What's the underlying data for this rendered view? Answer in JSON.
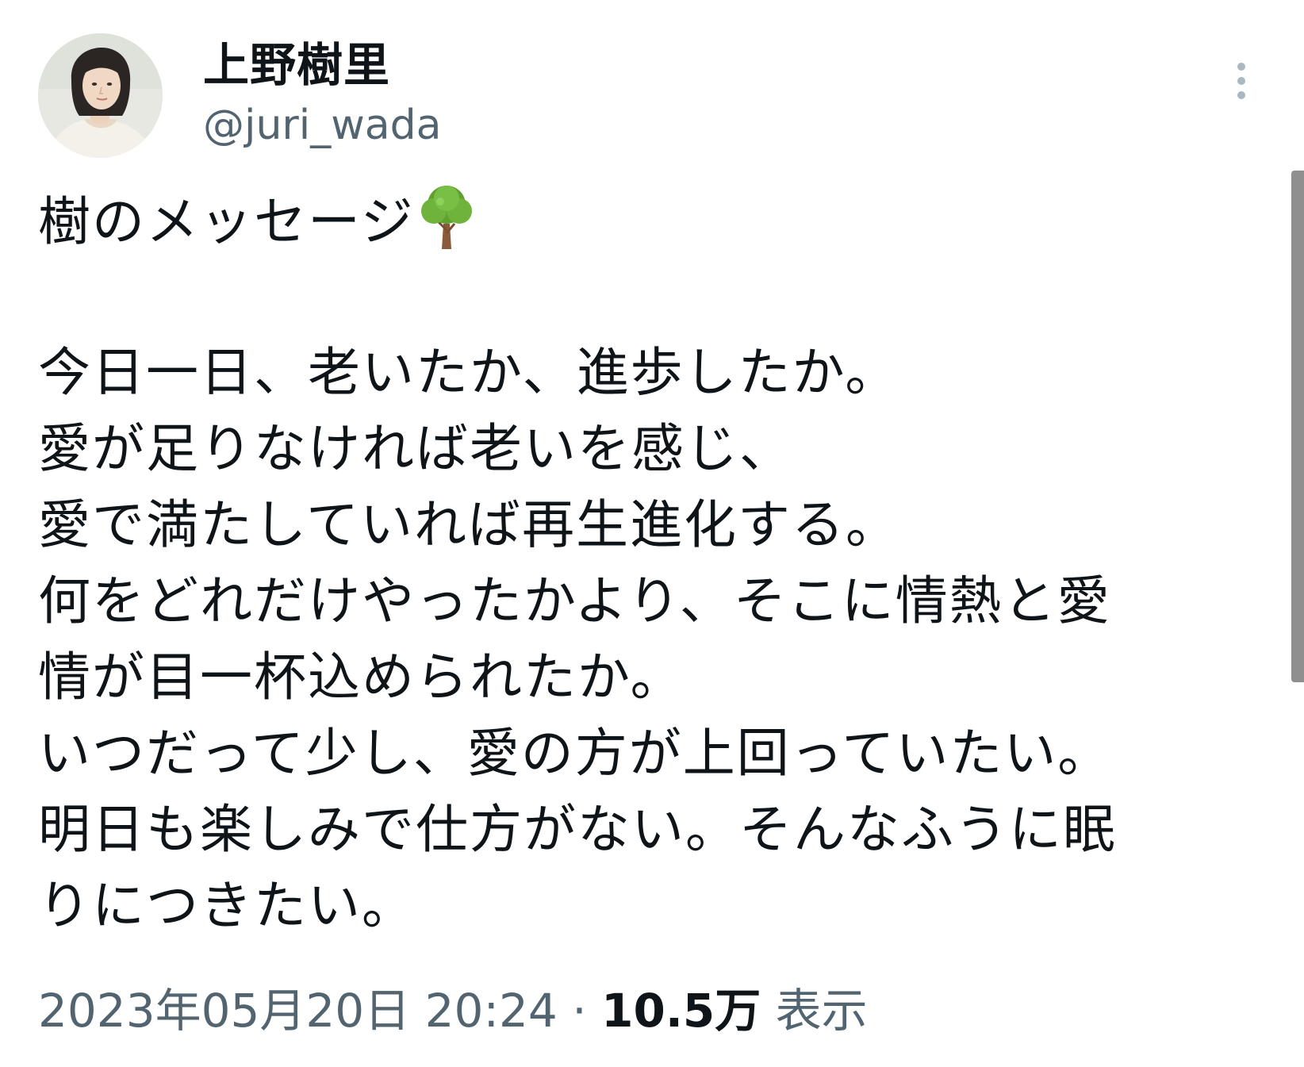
{
  "author": {
    "display_name": "上野樹里",
    "handle": "@juri_wada"
  },
  "tweet": {
    "title_text": "樹のメッセージ",
    "title_emoji": "tree-icon",
    "lines": [
      "今日一日、老いたか、進歩したか。",
      "愛が足りなければ老いを感じ、",
      "愛で満たしていれば再生進化する。",
      "何をどれだけやったかより、そこに情熱と愛",
      "情が目一杯込められたか。",
      "いつだって少し、愛の方が上回っていたい。",
      "明日も楽しみで仕方がない。そんなふうに眠",
      "りにつきたい。"
    ]
  },
  "meta": {
    "timestamp": "2023年05月20日 20:24",
    "separator": " · ",
    "views_count": "10.5万",
    "views_label": "表示"
  },
  "icons": {
    "more": "more-vertical-icon",
    "tree": "tree-icon"
  },
  "colors": {
    "text_primary": "#0f1419",
    "text_secondary": "#536471",
    "more_icon": "#aab8c2",
    "scrollbar": "#8f8f8f"
  }
}
